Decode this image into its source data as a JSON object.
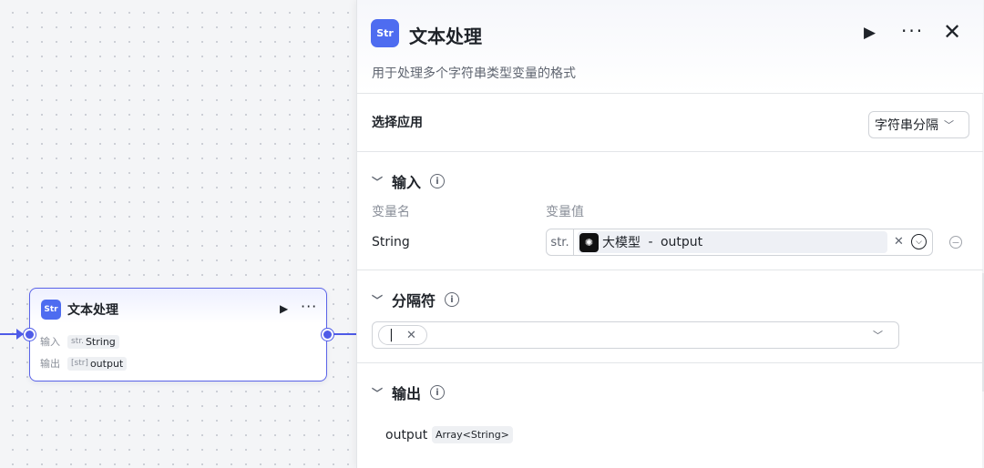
{
  "node": {
    "title": "文本处理",
    "icon": "Str",
    "input_label": "输入",
    "input_type_prefix": "str.",
    "input_value": "String",
    "output_label": "输出",
    "output_type_prefix": "[str]",
    "output_value": "output",
    "run_glyph": "▶",
    "more_glyph": "···"
  },
  "panel": {
    "title": "文本处理",
    "icon": "Str",
    "description": "用于处理多个字符串类型变量的格式",
    "run_glyph": "▶",
    "more_glyph": "···",
    "close_glyph": "✕",
    "app": {
      "label": "选择应用",
      "selected": "字符串分隔"
    },
    "input": {
      "label": "输入",
      "col_name": "变量名",
      "col_value": "变量值",
      "row": {
        "name": "String",
        "type": "str.",
        "ref_source": "大模型",
        "ref_sep": " - ",
        "ref_field": "output"
      }
    },
    "separator": {
      "label": "分隔符",
      "tag": "|"
    },
    "output": {
      "label": "输出",
      "name": "output",
      "type": "Array<String>"
    }
  },
  "colors": {
    "accent": "#4e5be8",
    "icon_bg": "#4e6cf0"
  }
}
